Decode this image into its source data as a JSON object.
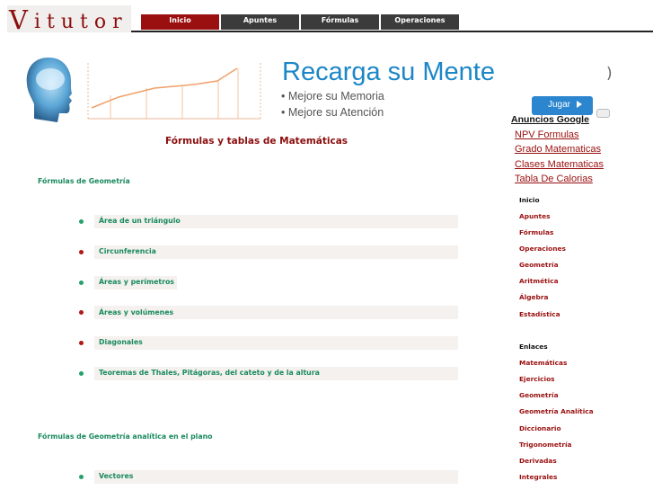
{
  "logo": {
    "first_letter": "V",
    "rest": "itutor"
  },
  "nav": {
    "tabs": [
      "Inicio",
      "Apuntes",
      "Fórmulas",
      "Operaciones"
    ],
    "active_index": 0
  },
  "banner": {
    "title": "Recarga su Mente",
    "lines": [
      "• Mejore su Memoria",
      "• Mejore su Atención"
    ],
    "button": "Jugar"
  },
  "main": {
    "title": "Fórmulas y tablas de Matemáticas",
    "sections": [
      {
        "heading": "Fórmulas de Geometría",
        "items": [
          {
            "label": "Área de un triángulo",
            "bullet": "green"
          },
          {
            "label": "Circunferencia",
            "bullet": "red"
          },
          {
            "label": "Áreas y perímetros",
            "bullet": "green"
          },
          {
            "label": "Áreas y volúmenes",
            "bullet": "red"
          },
          {
            "label": "Diagonales",
            "bullet": "red"
          },
          {
            "label": "Teoremas de Thales, Pitágoras, del cateto y de la altura",
            "bullet": "green"
          }
        ]
      },
      {
        "heading": "Fórmulas de Geometría analítica en el plano",
        "items": [
          {
            "label": "Vectores",
            "bullet": "green"
          }
        ]
      }
    ]
  },
  "sidebar": {
    "ads_title": "Anuncios Google",
    "ads": [
      "NPV Formulas",
      "Grado Matematicas",
      "Clases Matematicas",
      "Tabla De Calorias"
    ],
    "menu": [
      "Inicio",
      "Apuntes",
      "Fórmulas",
      "Operaciones",
      "Geometría",
      "Aritmética",
      "Álgebra",
      "Estadística"
    ],
    "links_title": "Enlaces",
    "links": [
      "Matemáticas",
      "Ejercicios",
      "Geometría",
      "Geometría Analítica",
      "Diccionario",
      "Trigonometría",
      "Derivadas",
      "Integrales"
    ]
  },
  "colors": {
    "brand": "#8b0d0d",
    "accent_green": "#1a8a5e",
    "banner_blue": "#1d86c7",
    "nav_dark": "#3b3b3b"
  }
}
